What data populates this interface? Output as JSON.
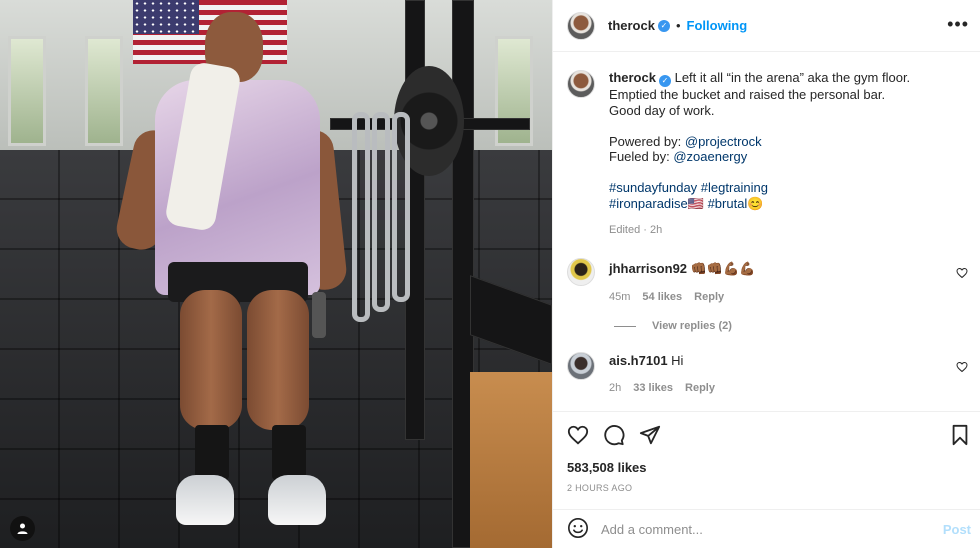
{
  "post": {
    "username": "therock",
    "following_label": "Following",
    "more_icon": "more-options-icon",
    "caption": {
      "username": "therock",
      "line1": "Left it all “in the arena” aka the gym floor.",
      "line2": "Emptied the bucket and raised the personal bar.",
      "line3": "Good day of work.",
      "powered_by": "Powered by: ",
      "powered_by_handle": "@projectrock",
      "fueled_by": "Fueled by: ",
      "fueled_by_handle": "@zoaenergy",
      "hashtags1": "#sundayfunday #legtraining",
      "hashtags2": "#ironparadise🇺🇸 #brutal😊",
      "edited": "Edited · 2h"
    }
  },
  "comments": [
    {
      "username": "jhharrison92",
      "text": "👊🏾👊🏾💪🏾💪🏾",
      "time": "45m",
      "likes": "54 likes",
      "reply_label": "Reply",
      "view_replies": "View replies (2)"
    },
    {
      "username": "ais.h7101",
      "text": "Hi",
      "time": "2h",
      "likes": "33 likes",
      "reply_label": "Reply"
    }
  ],
  "actions": {
    "likes_count": "583,508 likes",
    "timestamp": "2 HOURS AGO",
    "icons": [
      "heart-icon",
      "comment-icon",
      "share-icon",
      "bookmark-icon"
    ]
  },
  "composer": {
    "placeholder": "Add a comment...",
    "post_label": "Post",
    "emoji_icon": "emoji-icon"
  },
  "colors": {
    "link": "#00376b",
    "accent": "#0095f6",
    "verified": "#3897f0",
    "muted": "#8e8e8e"
  }
}
